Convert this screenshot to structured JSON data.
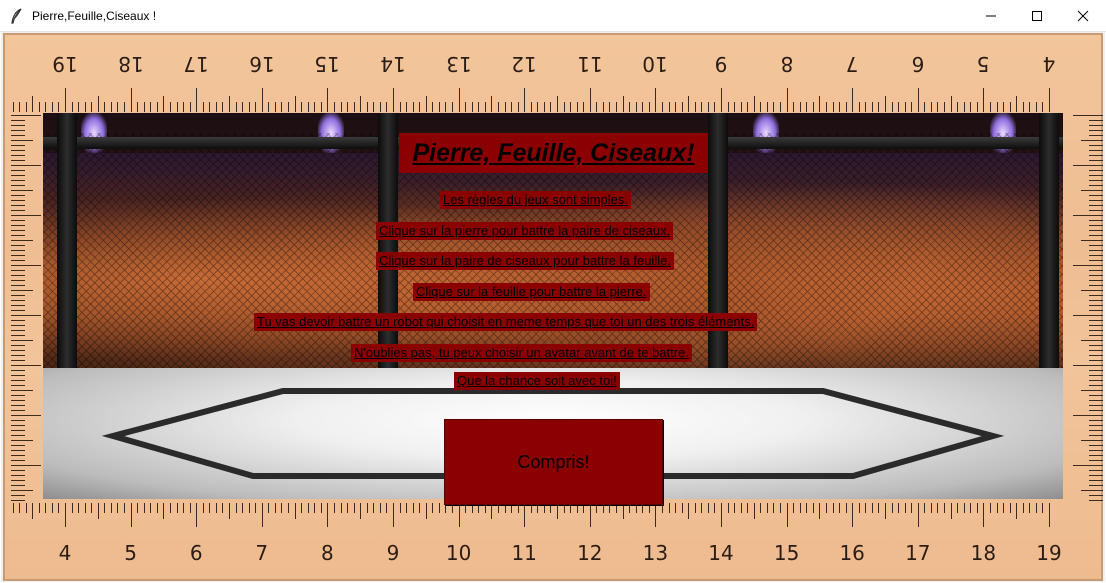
{
  "window": {
    "title": "Pierre,Feuille,Ciseaux !",
    "minimize_icon": "minimize-icon",
    "maximize_icon": "maximize-icon",
    "close_icon": "close-icon",
    "app_icon": "feather-icon"
  },
  "background": {
    "ruler_top_numbers": [
      "19",
      "18",
      "17",
      "16",
      "15",
      "14",
      "13",
      "12",
      "11",
      "10",
      "9",
      "8",
      "7",
      "6",
      "5",
      "4"
    ],
    "ruler_bottom_numbers": [
      "4",
      "5",
      "6",
      "7",
      "8",
      "9",
      "10",
      "11",
      "12",
      "13",
      "14",
      "15",
      "16",
      "17",
      "18",
      "19"
    ]
  },
  "rules": {
    "heading": "Pierre, Feuille, Ciseaux!",
    "lines": [
      "Les règles du jeux sont simples.",
      "Clique sur la pierre pour battre la paire de ciseaux.",
      "Clique sur la paire de ciseaux pour battre la feuille.",
      "Clique sur la feuille pour battre la pierre.",
      "Tu vas devoir battre un robot qui choisit en meme temps que toi un des trois éléments.",
      "N'oublies pas, tu peux choisir un avatar avant de te battre.",
      "Que la chance soit avec toi!"
    ],
    "button_label": "Compris!"
  },
  "colors": {
    "label_background": "#8b0000",
    "ruler_wood": "#f3c59b"
  }
}
